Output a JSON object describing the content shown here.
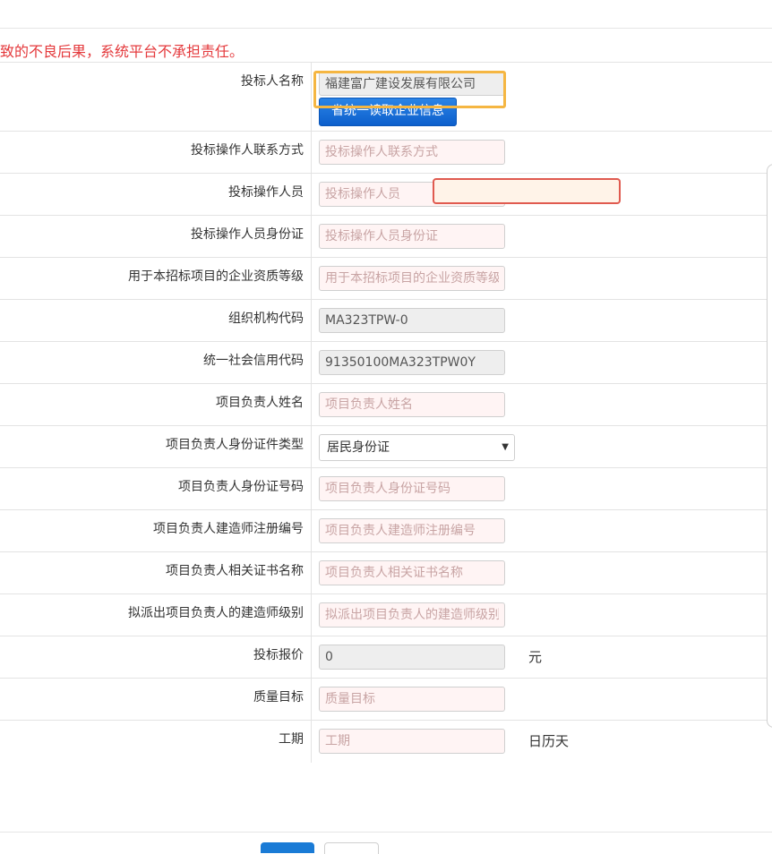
{
  "warning_text": "致的不良后果，系统平台不承担责任。",
  "form": {
    "bidder_name": {
      "label": "投标人名称",
      "value": "福建富广建设发展有限公司",
      "read_button": "省统一读取企业信息"
    },
    "operator_contact": {
      "label": "投标操作人联系方式",
      "placeholder": "投标操作人联系方式"
    },
    "operator": {
      "label": "投标操作人员",
      "placeholder": "投标操作人员"
    },
    "operator_id": {
      "label": "投标操作人员身份证",
      "placeholder": "投标操作人员身份证"
    },
    "qualification_level": {
      "label": "用于本招标项目的企业资质等级",
      "placeholder": "用于本招标项目的企业资质等级"
    },
    "org_code": {
      "label": "组织机构代码",
      "value": "MA323TPW-0"
    },
    "credit_code": {
      "label": "统一社会信用代码",
      "value": "91350100MA323TPW0Y"
    },
    "manager_name": {
      "label": "项目负责人姓名",
      "placeholder": "项目负责人姓名"
    },
    "manager_id_type": {
      "label": "项目负责人身份证件类型",
      "selected": "居民身份证"
    },
    "manager_id_number": {
      "label": "项目负责人身份证号码",
      "placeholder": "项目负责人身份证号码"
    },
    "manager_constructor_reg": {
      "label": "项目负责人建造师注册编号",
      "placeholder": "项目负责人建造师注册编号"
    },
    "manager_cert_name": {
      "label": "项目负责人相关证书名称",
      "placeholder": "项目负责人相关证书名称"
    },
    "manager_constructor_level": {
      "label": "拟派出项目负责人的建造师级别",
      "placeholder": "拟派出项目负责人的建造师级别"
    },
    "bid_price": {
      "label": "投标报价",
      "value": "0",
      "unit": "元"
    },
    "quality_target": {
      "label": "质量目标",
      "placeholder": "质量目标"
    },
    "duration": {
      "label": "工期",
      "placeholder": "工期",
      "unit": "日历天"
    }
  },
  "icons": {
    "select_caret": "caret-down-icon"
  },
  "colors": {
    "warning": "#e4393c",
    "primary": "#1a7bd6",
    "focus": "#f5b642",
    "error_outline": "#e05a4f"
  }
}
